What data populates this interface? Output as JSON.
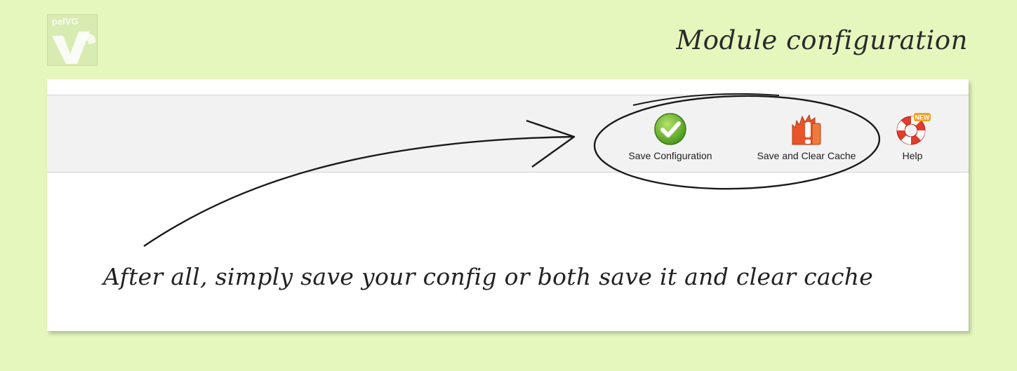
{
  "header": {
    "logo_text": "pelVG",
    "title": "Module configuration"
  },
  "toolbar": {
    "buttons": [
      {
        "label": "Save Configuration",
        "icon": "check-circle-icon"
      },
      {
        "label": "Save and Clear Cache",
        "icon": "burst-clear-cache-icon"
      },
      {
        "label": "Help",
        "icon": "lifebuoy-icon",
        "badge": "NEW"
      }
    ]
  },
  "annotation": {
    "text": "After all, simply save your config or both save it and clear cache"
  },
  "colors": {
    "background": "#e5f7bd",
    "panel": "#ffffff",
    "toolbar": "#f2f2f2",
    "accent_green": "#6ab82e",
    "accent_orange": "#e8552a",
    "help_red": "#e33c2a"
  }
}
